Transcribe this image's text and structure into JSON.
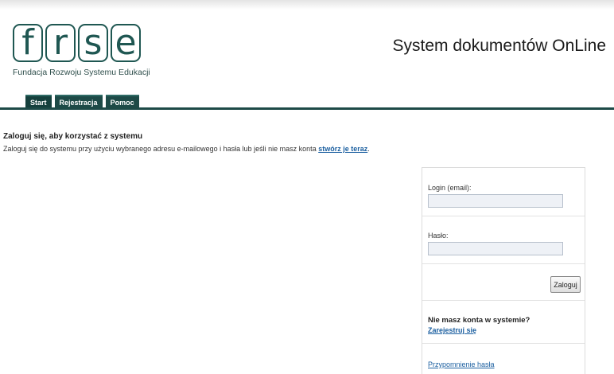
{
  "header": {
    "logo_letters": [
      "f",
      "r",
      "s",
      "e"
    ],
    "logo_caption": "Fundacja Rozwoju Systemu Edukacji",
    "system_title": "System dokumentów OnLine"
  },
  "nav": {
    "tabs": [
      {
        "label": "Start"
      },
      {
        "label": "Rejestracja"
      },
      {
        "label": "Pomoc"
      }
    ]
  },
  "main": {
    "heading": "Zaloguj się, aby korzystać z systemu",
    "subtext": "Zaloguj się do systemu przy użyciu wybranego adresu e-mailowego i hasła lub jeśli nie masz konta",
    "create_link": "stwórz je teraz",
    "create_suffix": "."
  },
  "login_panel": {
    "login_label": "Login (email):",
    "login_value": "",
    "password_label": "Hasło:",
    "password_value": "",
    "submit_label": "Zaloguj",
    "no_account_text": "Nie masz konta w systemie?",
    "register_link": "Zarejestruj się",
    "remind_link": "Przypomnienie hasła"
  },
  "colors": {
    "brand": "#1d4a47",
    "link": "#1b5fa0"
  }
}
